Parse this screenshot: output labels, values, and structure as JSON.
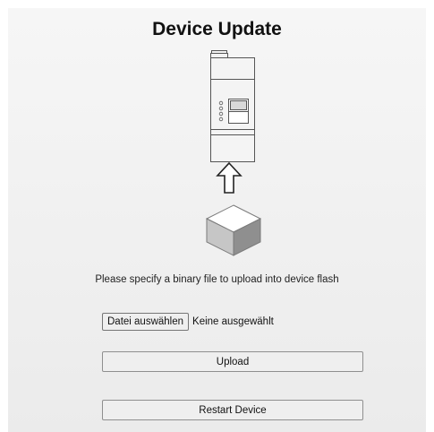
{
  "page": {
    "title": "Device Update",
    "instruction": "Please specify a binary file to upload into device flash"
  },
  "file_input": {
    "button_label": "Datei auswählen",
    "status": "Keine ausgewählt"
  },
  "buttons": {
    "upload_label": "Upload",
    "restart_label": "Restart Device"
  },
  "icons": {
    "device": "din-rail-device-icon",
    "arrow": "arrow-up-icon",
    "cube": "binary-cube-icon"
  }
}
